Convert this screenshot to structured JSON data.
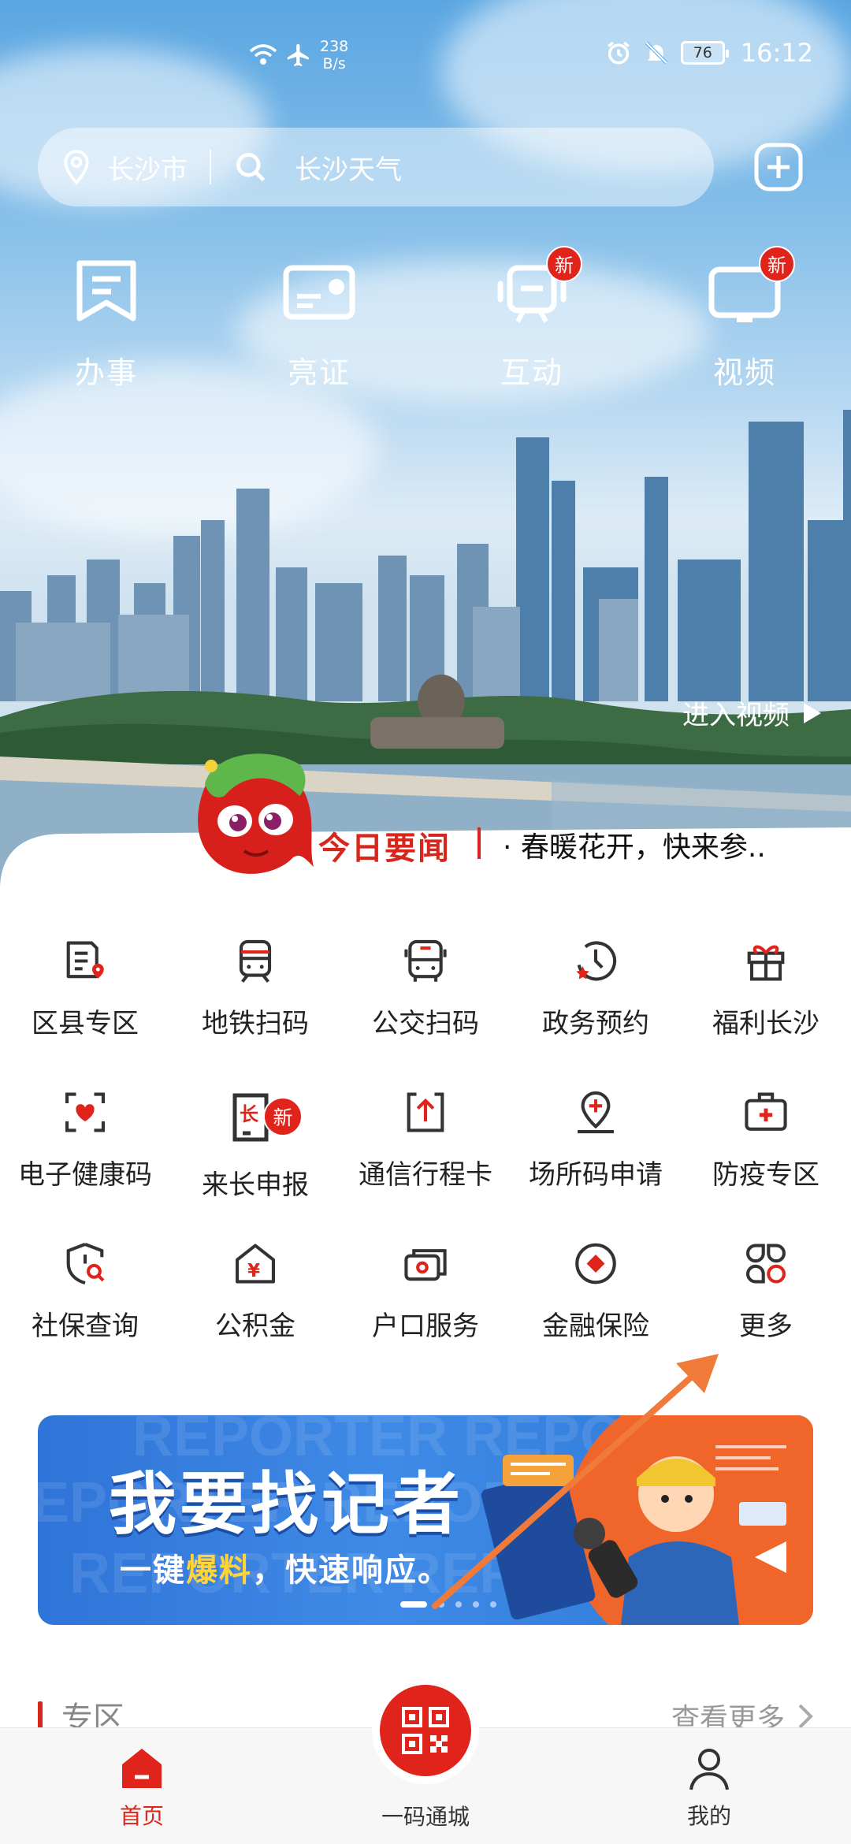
{
  "status_bar": {
    "net_speed_value": "238",
    "net_speed_unit": "B/s",
    "battery": "76",
    "time": "16:12"
  },
  "search": {
    "city": "长沙市",
    "query": "长沙天气"
  },
  "top_nav": [
    {
      "label": "办事",
      "icon": "banshi-icon",
      "badge": ""
    },
    {
      "label": "亮证",
      "icon": "id-card-icon",
      "badge": ""
    },
    {
      "label": "互动",
      "icon": "interact-icon",
      "badge": "新"
    },
    {
      "label": "视频",
      "icon": "video-icon",
      "badge": "新"
    }
  ],
  "hero": {
    "enter_video": "进入视频"
  },
  "news": {
    "title": "今日要闻",
    "headline": "· 春暖花开，快来参.."
  },
  "services": [
    {
      "label": "区县专区"
    },
    {
      "label": "地铁扫码"
    },
    {
      "label": "公交扫码"
    },
    {
      "label": "政务预约"
    },
    {
      "label": "福利长沙"
    },
    {
      "label": "电子健康码"
    },
    {
      "label": "来长申报",
      "badge": "新",
      "icon_text": "长"
    },
    {
      "label": "通信行程卡"
    },
    {
      "label": "场所码申请"
    },
    {
      "label": "防疫专区"
    },
    {
      "label": "社保查询"
    },
    {
      "label": "公积金",
      "icon_text": "¥"
    },
    {
      "label": "户口服务"
    },
    {
      "label": "金融保险"
    },
    {
      "label": "更多"
    }
  ],
  "banner": {
    "title": "我要找记者",
    "sub_prefix": "一键",
    "sub_highlight": "爆料",
    "sub_suffix": "，快速响应。",
    "watermark": "REPORTER REPORTER"
  },
  "section": {
    "title": "专区",
    "more": "查看更多"
  },
  "tabbar": {
    "home": "首页",
    "center": "一码通城",
    "mine": "我的"
  },
  "colors": {
    "brand_red": "#e0241b",
    "annotation_orange": "#f07a3a",
    "banner_blue": "#3f8ae6"
  }
}
